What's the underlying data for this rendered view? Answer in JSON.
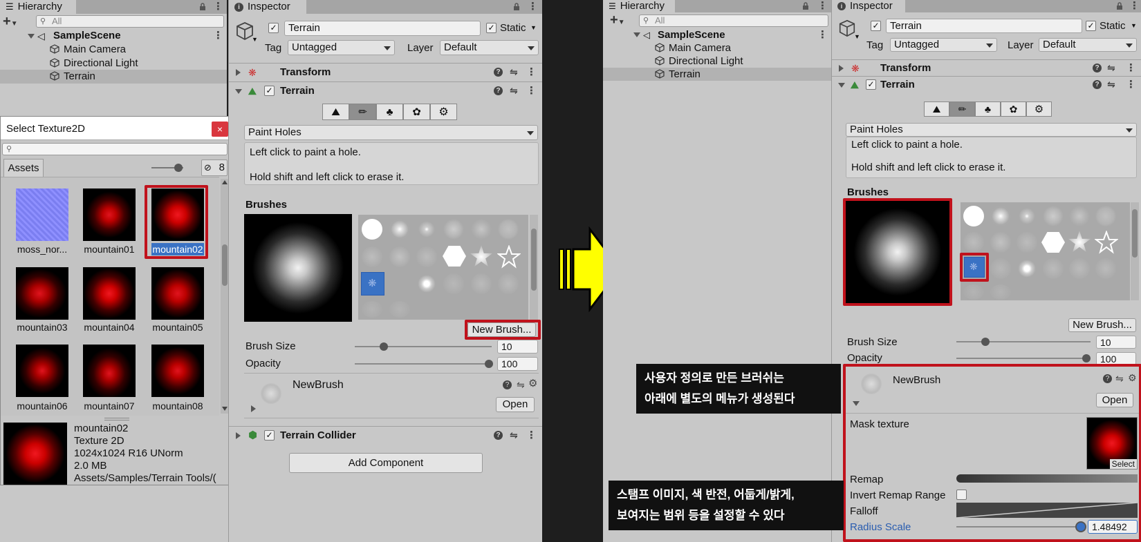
{
  "left": {
    "hierarchy": {
      "tab_label": "Hierarchy",
      "add_label": "+",
      "search_placeholder": "All",
      "scene_name": "SampleScene",
      "items": [
        "Main Camera",
        "Directional Light",
        "Terrain"
      ]
    },
    "select_texture": {
      "title": "Select Texture2D",
      "close_label": "×",
      "assets_tab": "Assets",
      "hidden_count": "8",
      "items": [
        "moss_nor...",
        "mountain01",
        "mountain02",
        "mountain03",
        "mountain04",
        "mountain05",
        "mountain06",
        "mountain07",
        "mountain08"
      ],
      "selected": "mountain02",
      "info": {
        "name": "mountain02",
        "type": "Texture 2D",
        "dims": "1024x1024  R16 UNorm",
        "size": "2.0 MB",
        "path": "Assets/Samples/Terrain Tools/("
      }
    },
    "inspector": {
      "tab_label": "Inspector",
      "object_name": "Terrain",
      "static_label": "Static",
      "tag_label": "Tag",
      "tag_value": "Untagged",
      "layer_label": "Layer",
      "layer_value": "Default",
      "transform_label": "Transform",
      "terrain_label": "Terrain",
      "tool_mode": "Paint Holes",
      "help_line1": "Left click to paint a hole.",
      "help_line2": "Hold shift and left click to erase it.",
      "brushes_label": "Brushes",
      "new_brush_label": "New Brush...",
      "brush_size_label": "Brush Size",
      "brush_size_value": "10",
      "brush_size_level": 0.2,
      "opacity_label": "Opacity",
      "opacity_value": "100",
      "opacity_level": 1.0,
      "newbrush_name": "NewBrush",
      "open_label": "Open",
      "collider_label": "Terrain Collider",
      "add_component_label": "Add Component"
    }
  },
  "right": {
    "hierarchy": {
      "tab_label": "Hierarchy",
      "add_label": "+",
      "search_placeholder": "All",
      "scene_name": "SampleScene",
      "items": [
        "Main Camera",
        "Directional Light",
        "Terrain"
      ]
    },
    "inspector": {
      "tab_label": "Inspector",
      "object_name": "Terrain",
      "static_label": "Static",
      "tag_label": "Tag",
      "tag_value": "Untagged",
      "layer_label": "Layer",
      "layer_value": "Default",
      "transform_label": "Transform",
      "terrain_label": "Terrain",
      "tool_mode": "Paint Holes",
      "help_line1": "Left click to paint a hole.",
      "help_line2": "Hold shift and left click to erase it.",
      "brushes_label": "Brushes",
      "new_brush_label": "New Brush...",
      "brush_size_label": "Brush Size",
      "brush_size_value": "10",
      "opacity_label": "Opacity",
      "opacity_value": "100",
      "newbrush_name": "NewBrush",
      "open_label": "Open",
      "mask_texture_label": "Mask texture",
      "select_label": "Select",
      "remap_label": "Remap",
      "invert_label": "Invert Remap Range",
      "falloff_label": "Falloff",
      "radius_label": "Radius Scale",
      "radius_value": "1.48492"
    }
  },
  "annotations": {
    "note1_line1": "사용자 정의로 만든 브러쉬는",
    "note1_line2": "아래에 별도의 메뉴가 생성된다",
    "note2_line1": "스탬프 이미지, 색 반전, 어둡게/밝게,",
    "note2_line2": "보여지는 범위 등을 설정할 수 있다"
  },
  "colors": {
    "highlight_red": "#c0121c",
    "arrow_yellow": "#ffff00",
    "selection_blue": "#3a72c4",
    "link_blue": "#2a5db0"
  },
  "icons": {
    "hierarchy": "list-icon",
    "inspector": "info-icon",
    "lock": "lock-icon",
    "menu": "kebab-icon",
    "help": "help-icon",
    "presets": "sliders-icon",
    "gear": "gear-icon"
  }
}
